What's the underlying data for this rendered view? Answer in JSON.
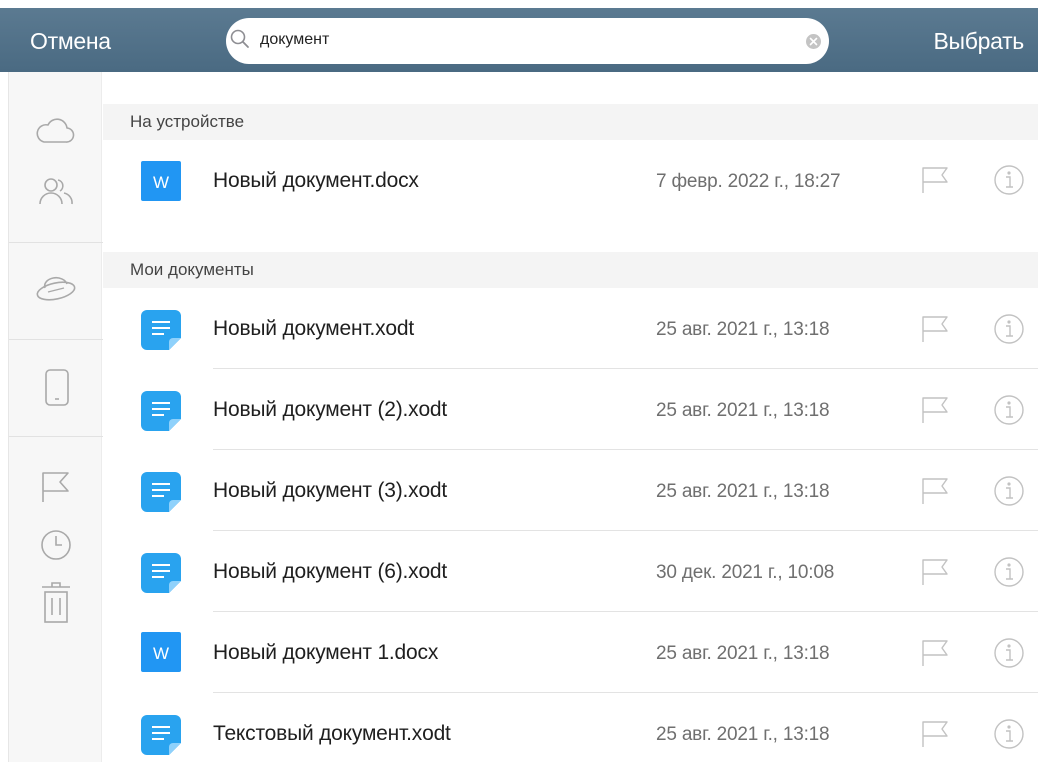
{
  "topbar": {
    "cancel_label": "Отмена",
    "choose_label": "Выбрать",
    "search_value": "документ"
  },
  "sidebar": {
    "items": [
      {
        "icon": "cloud-icon"
      },
      {
        "icon": "shared-users-icon"
      },
      {
        "icon": "yandex-disk-icon"
      },
      {
        "icon": "device-icon"
      },
      {
        "icon": "flag-icon"
      },
      {
        "icon": "recent-clock-icon"
      },
      {
        "icon": "trash-icon"
      }
    ]
  },
  "sections": [
    {
      "title": "На устройстве",
      "files": [
        {
          "name": "Новый документ.docx",
          "date": "7 февр. 2022 г., 18:27",
          "type": "word"
        }
      ]
    },
    {
      "title": "Мои документы",
      "files": [
        {
          "name": "Новый документ.xodt",
          "date": "25 авг. 2021 г., 13:18",
          "type": "text"
        },
        {
          "name": "Новый документ (2).xodt",
          "date": "25 авг. 2021 г., 13:18",
          "type": "text"
        },
        {
          "name": "Новый документ (3).xodt",
          "date": "25 авг. 2021 г., 13:18",
          "type": "text"
        },
        {
          "name": "Новый документ (6).xodt",
          "date": "30 дек. 2021 г., 10:08",
          "type": "text"
        },
        {
          "name": "Новый документ 1.docx",
          "date": "25 авг. 2021 г., 13:18",
          "type": "word"
        },
        {
          "name": "Текстовый документ.xodt",
          "date": "25 авг. 2021 г., 13:18",
          "type": "text"
        }
      ]
    }
  ],
  "colors": {
    "topbar": "#4f6f87",
    "word_icon": "#2196f3",
    "text_icon": "#29a3ef",
    "icon_gray": "#b8b8b8"
  }
}
